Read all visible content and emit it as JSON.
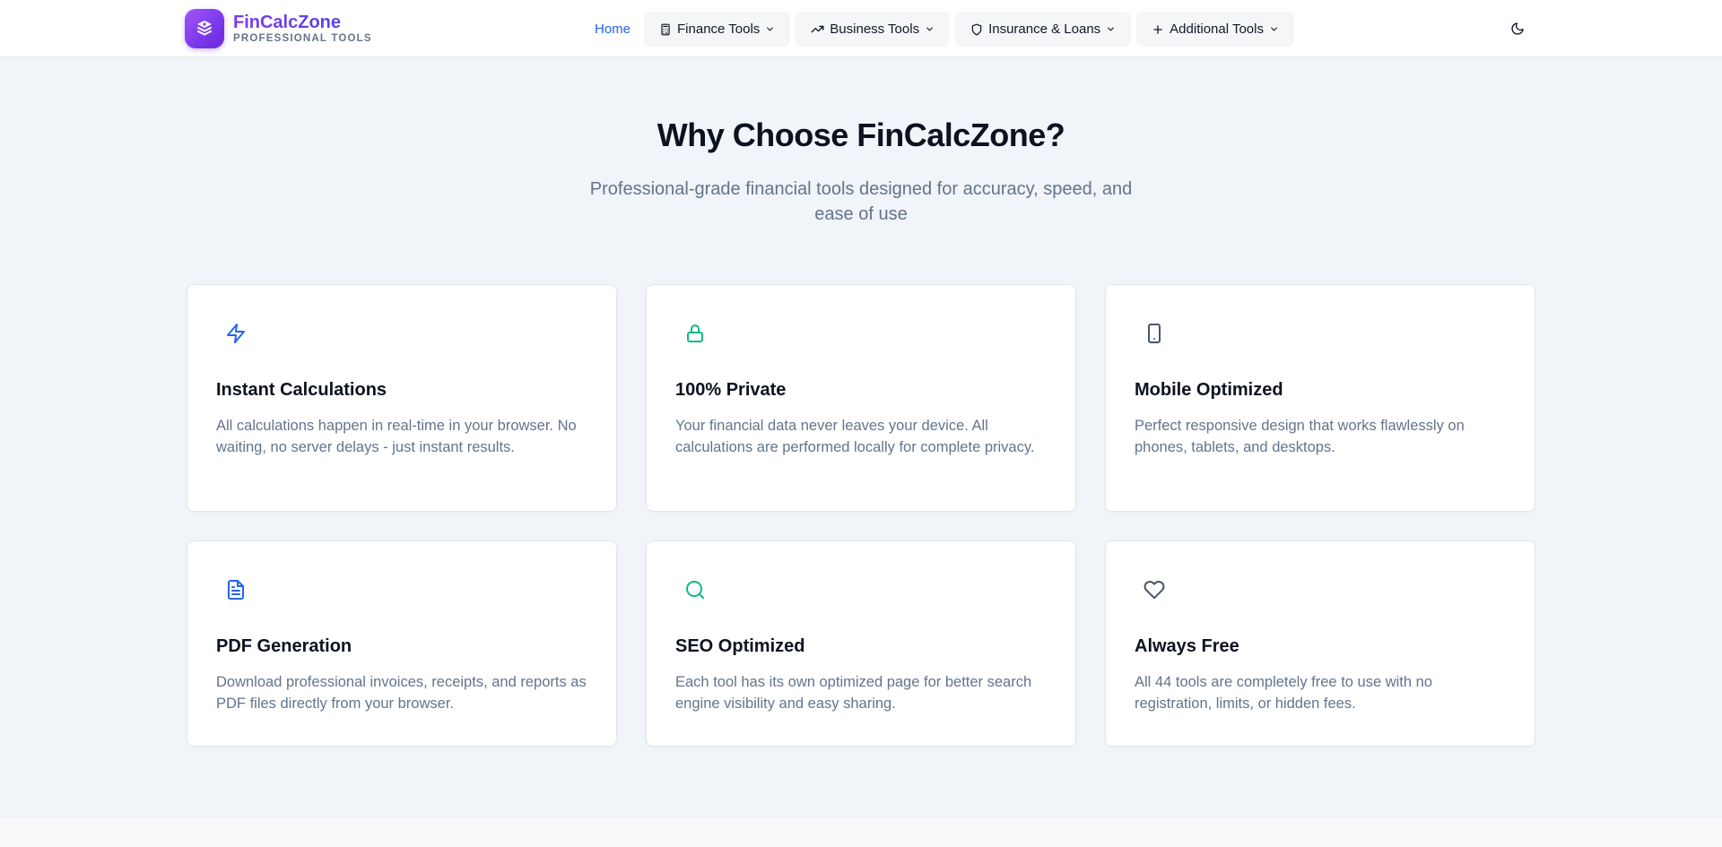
{
  "header": {
    "brand_name": "FinCalcZone",
    "brand_tagline": "PROFESSIONAL TOOLS",
    "nav": {
      "home": "Home",
      "items": [
        {
          "label": "Finance Tools",
          "icon": "calculator-icon"
        },
        {
          "label": "Business Tools",
          "icon": "trending-up-icon"
        },
        {
          "label": "Insurance & Loans",
          "icon": "shield-icon"
        },
        {
          "label": "Additional Tools",
          "icon": "plus-icon"
        }
      ]
    },
    "theme_toggle_icon": "moon-icon"
  },
  "hero": {
    "title": "Why Choose FinCalcZone?",
    "subtitle": "Professional-grade financial tools designed for accuracy, speed, and ease of use"
  },
  "features": [
    {
      "icon": "lightning-icon",
      "color": "#2563eb",
      "title": "Instant Calculations",
      "description": "All calculations happen in real-time in your browser. No waiting, no server delays - just instant results."
    },
    {
      "icon": "lock-icon",
      "color": "#10b981",
      "title": "100% Private",
      "description": "Your financial data never leaves your device. All calculations are performed locally for complete privacy."
    },
    {
      "icon": "mobile-icon",
      "color": "#475569",
      "title": "Mobile Optimized",
      "description": "Perfect responsive design that works flawlessly on phones, tablets, and desktops."
    },
    {
      "icon": "document-icon",
      "color": "#2563eb",
      "title": "PDF Generation",
      "description": "Download professional invoices, receipts, and reports as PDF files directly from your browser."
    },
    {
      "icon": "search-icon",
      "color": "#10b981",
      "title": "SEO Optimized",
      "description": "Each tool has its own optimized page for better search engine visibility and easy sharing."
    },
    {
      "icon": "heart-icon",
      "color": "#475569",
      "title": "Always Free",
      "description": "All 44 tools are completely free to use with no registration, limits, or hidden fees."
    }
  ],
  "colors": {
    "accent": "#2563eb",
    "brand": "#7c3aed",
    "success": "#10b981",
    "background": "#f1f4f8"
  }
}
